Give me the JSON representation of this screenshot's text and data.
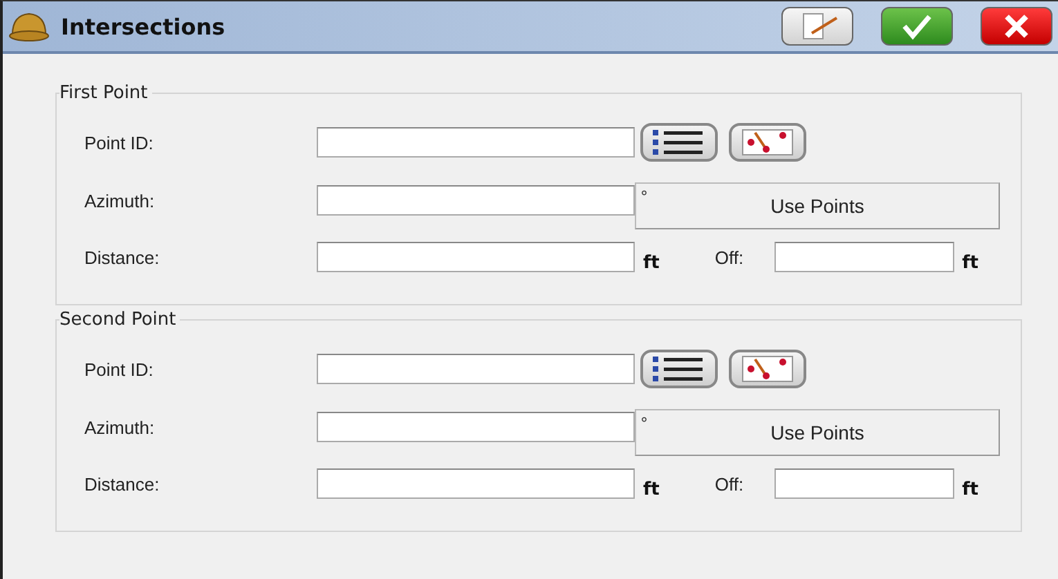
{
  "window": {
    "title": "Intersections"
  },
  "groups": [
    {
      "title": "First Point",
      "point_id": {
        "label": "Point ID:"
      },
      "azimuth": {
        "label": "Azimuth:",
        "unit": "°"
      },
      "use_points": "Use Points",
      "distance": {
        "label": "Distance:",
        "unit": "ft"
      },
      "offset": {
        "label": "Off:",
        "unit": "ft"
      }
    },
    {
      "title": "Second Point",
      "point_id": {
        "label": "Point ID:"
      },
      "azimuth": {
        "label": "Azimuth:",
        "unit": "°"
      },
      "use_points": "Use Points",
      "distance": {
        "label": "Distance:",
        "unit": "ft"
      },
      "offset": {
        "label": "Off:",
        "unit": "ft"
      }
    }
  ]
}
